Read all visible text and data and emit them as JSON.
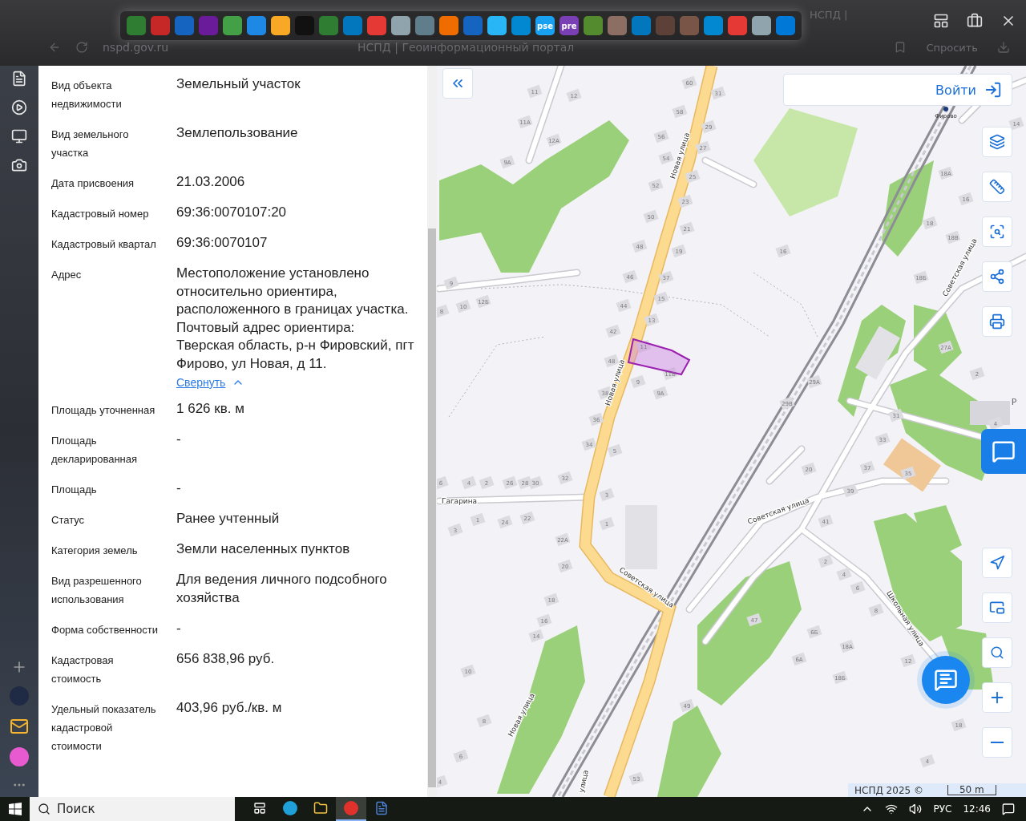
{
  "browser": {
    "tab_title": "НСПД |",
    "address": "nspd.gov.ru",
    "page_title": "НСПД | Геоинформационный портал",
    "ask_button": "Спросить"
  },
  "dock": {
    "text_tiles": [
      "pse",
      "pre"
    ]
  },
  "details": {
    "rows": [
      {
        "label": "Вид объекта недвижимости",
        "value": "Земельный участок"
      },
      {
        "label": "Вид земельного участка",
        "value": "Землепользование"
      },
      {
        "label": "Дата присвоения",
        "value": "21.03.2006"
      },
      {
        "label": "Кадастровый номер",
        "value": "69:36:0070107:20"
      },
      {
        "label": "Кадастровый квартал",
        "value": "69:36:0070107"
      },
      {
        "label": "Адрес",
        "value": "Местоположение установлено относительно ориентира, расположенного в границах участка. Почтовый адрес ориентира: Тверская область, р-н Фировский, пгт Фирово, ул Новая, д 11.",
        "link": "Свернуть",
        "expanded": true
      },
      {
        "label": "Площадь уточненная",
        "value": "1 626 кв. м"
      },
      {
        "label": "Площадь декларированная",
        "value": "-"
      },
      {
        "label": "Площадь",
        "value": "-"
      },
      {
        "label": "Статус",
        "value": "Ранее учтенный"
      },
      {
        "label": "Категория земель",
        "value": "Земли населенных пунктов"
      },
      {
        "label": "Вид разрешенного использования",
        "value": "Для ведения личного подсобного хозяйства"
      },
      {
        "label": "Форма собственности",
        "value": "-"
      },
      {
        "label": "Кадастровая стоимость",
        "value": "656 838,96 руб."
      },
      {
        "label": "Удельный показатель кадастровой стоимости",
        "value": "403,96 руб./кв. м"
      }
    ]
  },
  "map": {
    "login": "Войти",
    "place_label": "Фирово",
    "parking": "P",
    "attribution": "НСПД 2025 ©",
    "scale": "50 m",
    "streets": [
      "Новая улица",
      "Новая улица",
      "Новая улица",
      "Гагарина",
      "Советская улица",
      "Советская улица",
      "Советская улица",
      "Школьная улица",
      "улица"
    ],
    "houses": [
      "60",
      "11",
      "31",
      "12",
      "58",
      "11А",
      "14",
      "29",
      "56",
      "12А",
      "27",
      "54",
      "9А",
      "18А",
      "25",
      "52",
      "16",
      "23",
      "50",
      "18",
      "21",
      "18В",
      "48",
      "19",
      "16",
      "46",
      "37",
      "18Б",
      "9",
      "15",
      "12Б",
      "44",
      "10",
      "8",
      "13",
      "42",
      "11",
      "27А",
      "48",
      "11Б",
      "2",
      "9",
      "29А",
      "38",
      "9А",
      "29В",
      "31",
      "36",
      "4",
      "33",
      "34",
      "5",
      "37",
      "20",
      "35",
      "32",
      "6",
      "4",
      "2",
      "26",
      "28",
      "30",
      "39",
      "3",
      "22",
      "1",
      "24",
      "41",
      "1",
      "3",
      "22А",
      "2",
      "20",
      "4",
      "6",
      "18",
      "8",
      "47",
      "16",
      "6Б",
      "14",
      "18А",
      "6А",
      "12",
      "10",
      "18Б",
      "49",
      "8",
      "18",
      "6",
      "4",
      "53",
      "4"
    ]
  },
  "taskbar": {
    "search_placeholder": "Поиск",
    "apps": [
      {
        "kind": "taskview",
        "selected": false
      },
      {
        "kind": "edge",
        "selected": false
      },
      {
        "kind": "explorer",
        "selected": false
      },
      {
        "kind": "yandex",
        "selected": true
      },
      {
        "kind": "word",
        "selected": false
      }
    ],
    "language": "РУС",
    "time": "12:46"
  }
}
